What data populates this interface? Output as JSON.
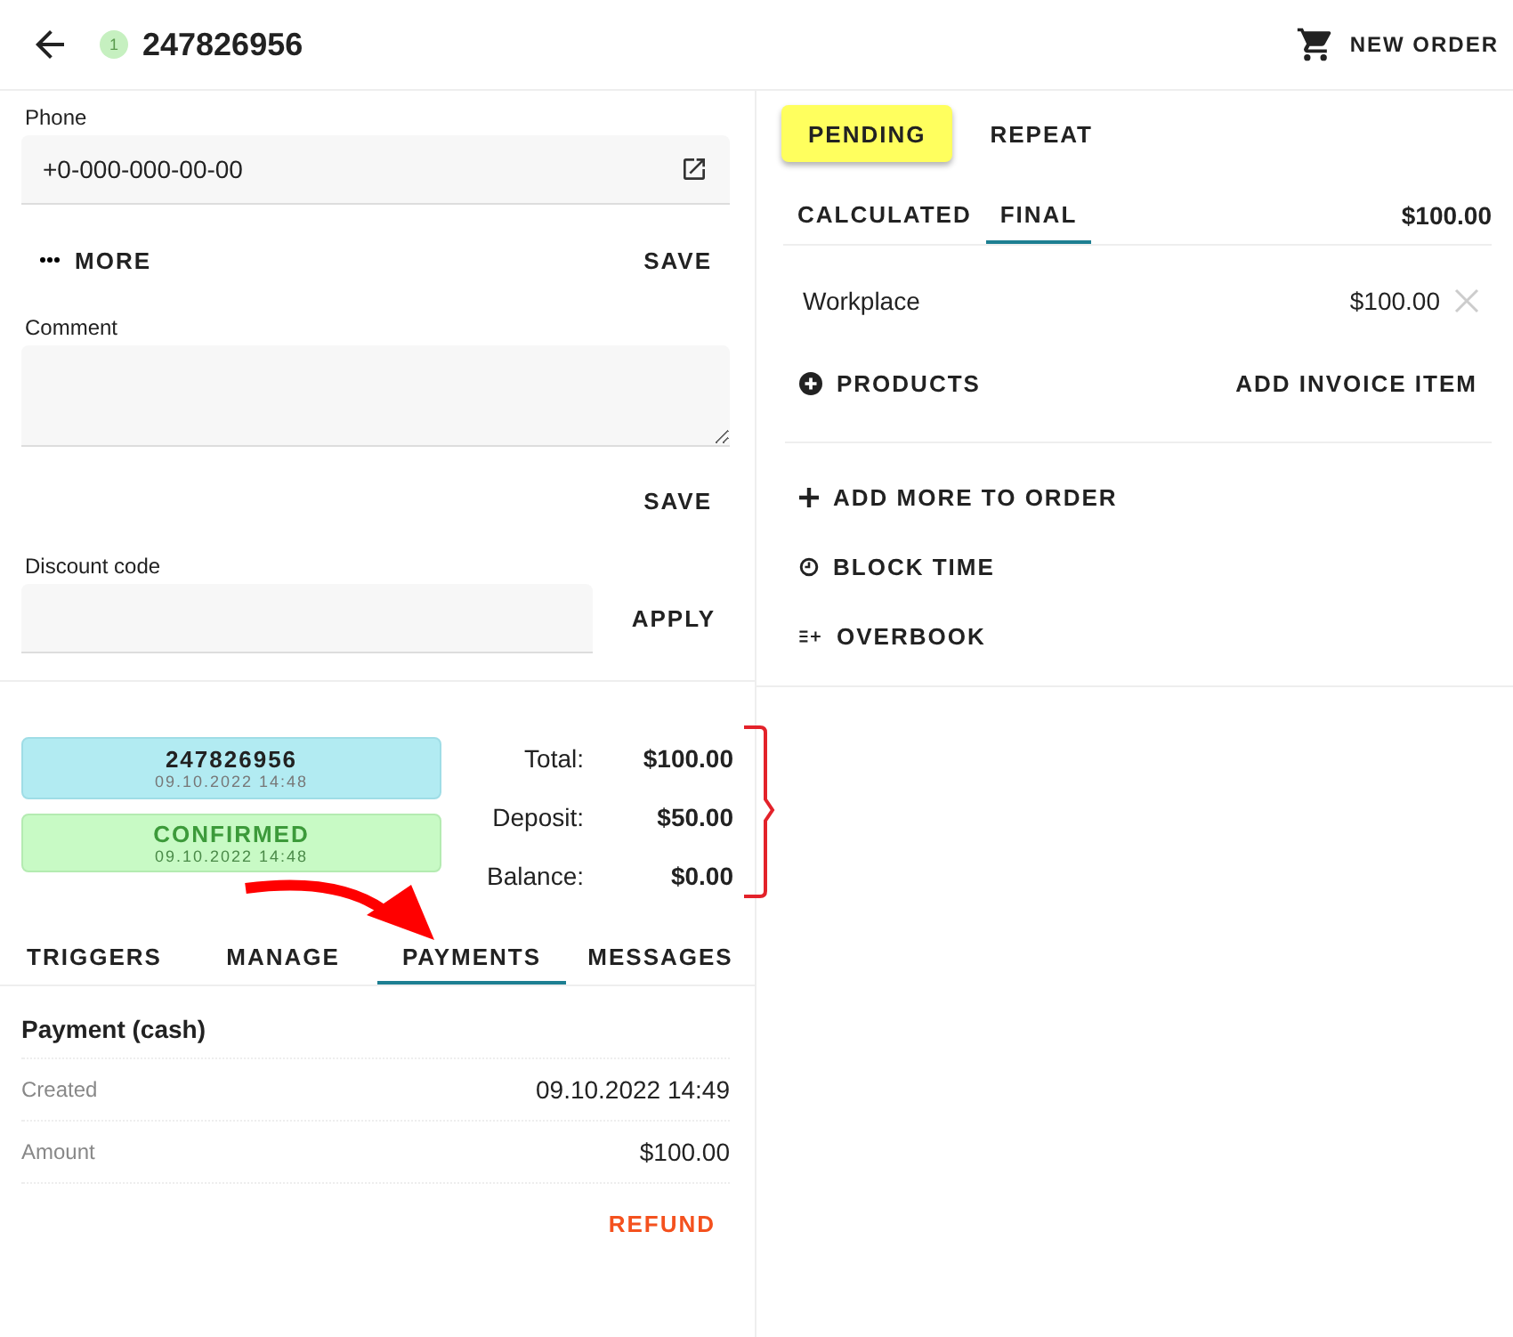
{
  "header": {
    "badge": "1",
    "title": "247826956",
    "new_order": "NEW ORDER"
  },
  "phone": {
    "label": "Phone",
    "value": "+0-000-000-00-00"
  },
  "more_button": "MORE",
  "save_phone": "SAVE",
  "comment": {
    "label": "Comment",
    "save": "SAVE"
  },
  "discount": {
    "label": "Discount code",
    "apply": "APPLY"
  },
  "statuses": [
    {
      "kind": "number",
      "title": "247826956",
      "time": "09.10.2022 14:48"
    },
    {
      "kind": "confirmed",
      "title": "CONFIRMED",
      "time": "09.10.2022 14:48"
    }
  ],
  "totals": [
    {
      "label": "Total:",
      "value": "$100.00"
    },
    {
      "label": "Deposit:",
      "value": "$50.00"
    },
    {
      "label": "Balance:",
      "value": "$0.00"
    }
  ],
  "tabs": [
    {
      "label": "TRIGGERS",
      "selected": false
    },
    {
      "label": "MANAGE",
      "selected": false
    },
    {
      "label": "PAYMENTS",
      "selected": true
    },
    {
      "label": "MESSAGES",
      "selected": false
    }
  ],
  "payment": {
    "title": "Payment (cash)",
    "rows": [
      {
        "label": "Created",
        "value": "09.10.2022 14:49"
      },
      {
        "label": "Amount",
        "value": "$100.00"
      }
    ],
    "refund": "REFUND"
  },
  "order_states": [
    {
      "label": "PENDING",
      "selected": true
    },
    {
      "label": "REPEAT",
      "selected": false
    }
  ],
  "price_tabs": [
    {
      "label": "CALCULATED",
      "selected": false
    },
    {
      "label": "FINAL",
      "selected": true
    }
  ],
  "price_total": "$100.00",
  "items": [
    {
      "name": "Workplace",
      "price": "$100.00"
    }
  ],
  "products_button": "PRODUCTS",
  "add_invoice_item": "ADD INVOICE ITEM",
  "actions": [
    {
      "kind": "add",
      "label": "ADD MORE TO ORDER"
    },
    {
      "kind": "clock",
      "label": "BLOCK TIME"
    },
    {
      "kind": "overbook",
      "label": "OVERBOOK"
    }
  ]
}
